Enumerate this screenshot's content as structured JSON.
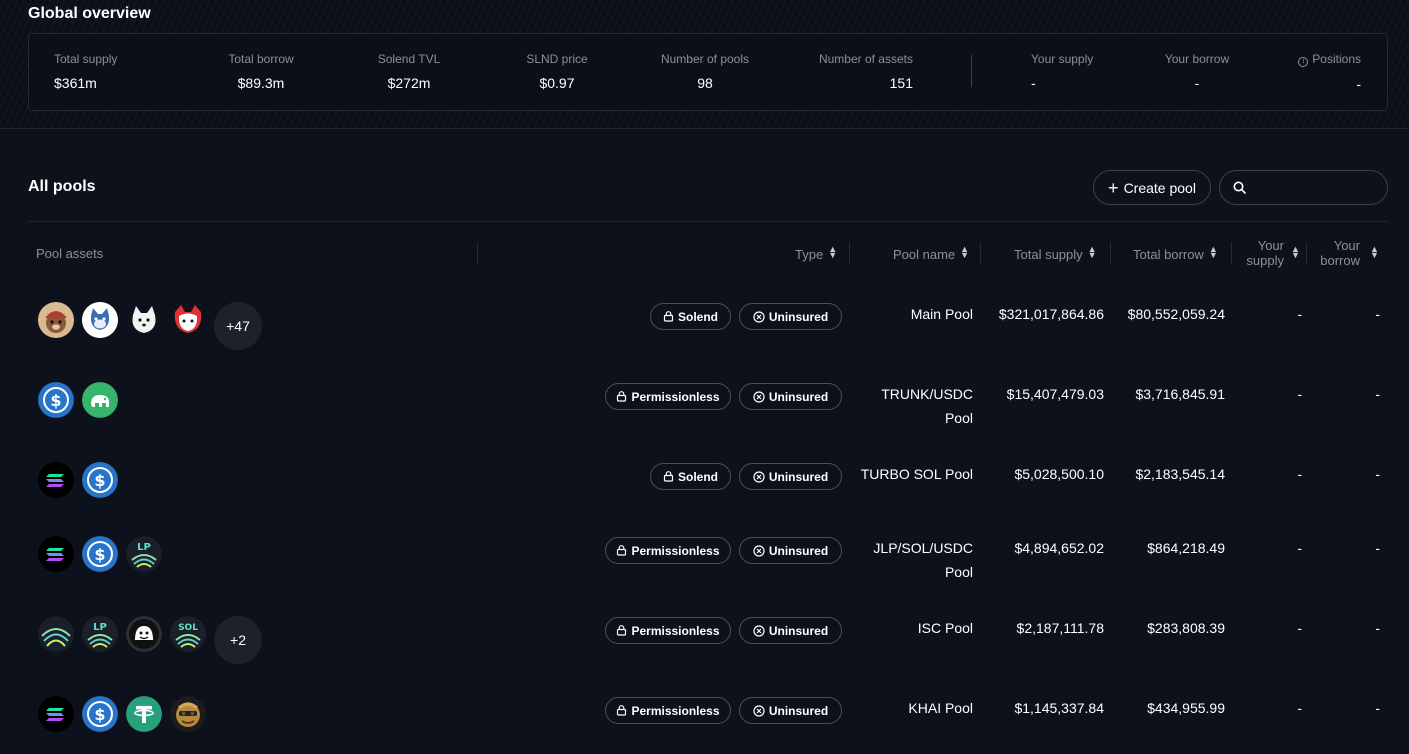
{
  "global": {
    "title": "Global overview",
    "stats": [
      {
        "label": "Total supply",
        "value": "$361m"
      },
      {
        "label": "Total borrow",
        "value": "$89.3m"
      },
      {
        "label": "Solend TVL",
        "value": "$272m"
      },
      {
        "label": "SLND price",
        "value": "$0.97"
      },
      {
        "label": "Number of pools",
        "value": "98"
      },
      {
        "label": "Number of assets",
        "value": "151"
      }
    ],
    "user_stats": [
      {
        "label": "Your supply",
        "value": "-"
      },
      {
        "label": "Your borrow",
        "value": "-"
      },
      {
        "label": "Positions",
        "value": "-"
      }
    ]
  },
  "pools": {
    "title": "All pools",
    "create_label": "Create pool",
    "search_placeholder": "",
    "columns": {
      "assets": "Pool assets",
      "type": "Type",
      "name": "Pool name",
      "total_supply": "Total supply",
      "total_borrow": "Total borrow",
      "your_supply_1": "Your",
      "your_supply_2": "supply",
      "your_borrow_1": "Your",
      "your_borrow_2": "borrow"
    },
    "rows": [
      {
        "more": "+47",
        "type": "Solend",
        "insurance": "Uninsured",
        "name_1": "Main Pool",
        "name_2": "",
        "supply": "$321,017,864.86",
        "borrow": "$80,552,059.24",
        "your_supply": "-",
        "your_borrow": "-"
      },
      {
        "more": "",
        "type": "Permissionless",
        "insurance": "Uninsured",
        "name_1": "TRUNK/USDC",
        "name_2": "Pool",
        "supply": "$15,407,479.03",
        "borrow": "$3,716,845.91",
        "your_supply": "-",
        "your_borrow": "-"
      },
      {
        "more": "",
        "type": "Solend",
        "insurance": "Uninsured",
        "name_1": "TURBO SOL Pool",
        "name_2": "",
        "supply": "$5,028,500.10",
        "borrow": "$2,183,545.14",
        "your_supply": "-",
        "your_borrow": "-"
      },
      {
        "more": "",
        "type": "Permissionless",
        "insurance": "Uninsured",
        "name_1": "JLP/SOL/USDC",
        "name_2": "Pool",
        "supply": "$4,894,652.02",
        "borrow": "$864,218.49",
        "your_supply": "-",
        "your_borrow": "-"
      },
      {
        "more": "+2",
        "type": "Permissionless",
        "insurance": "Uninsured",
        "name_1": "ISC Pool",
        "name_2": "",
        "supply": "$2,187,111.78",
        "borrow": "$283,808.39",
        "your_supply": "-",
        "your_borrow": "-"
      },
      {
        "more": "",
        "type": "Permissionless",
        "insurance": "Uninsured",
        "name_1": "KHAI Pool",
        "name_2": "",
        "supply": "$1,145,337.84",
        "borrow": "$434,955.99",
        "your_supply": "-",
        "your_borrow": "-"
      }
    ],
    "asset_labels": {
      "lp": "LP",
      "sol": "SOL"
    }
  },
  "colors": {
    "background": "#0d111b",
    "usdc": "#2775ca",
    "trunk": "#35b56b",
    "usdt": "#26a17b",
    "muted_text": "#8a909c",
    "border": "#3a404b"
  }
}
